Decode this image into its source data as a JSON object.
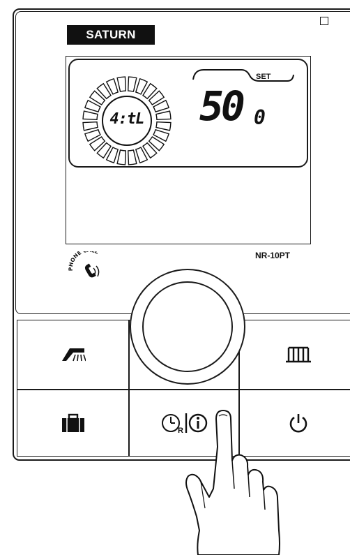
{
  "brand": "SATURN",
  "display": {
    "set_label": "SET",
    "dial_text": "4:tL",
    "main_value": "50",
    "small_digit": "0"
  },
  "model": "NR-10PT",
  "phone_call": "PHONE CALL",
  "buttons": [
    {
      "id": "hot-water",
      "icon": "shower-icon"
    },
    {
      "id": "heating",
      "icon": "radiator-icon"
    },
    {
      "id": "away",
      "icon": "suitcase-icon"
    },
    {
      "id": "reset-info",
      "icon": "clock-reset-info-icon",
      "label_r": "R"
    },
    {
      "id": "power",
      "icon": "power-icon"
    }
  ],
  "knob": {
    "icon": "rotary-knob"
  },
  "accent_color": "#111111"
}
